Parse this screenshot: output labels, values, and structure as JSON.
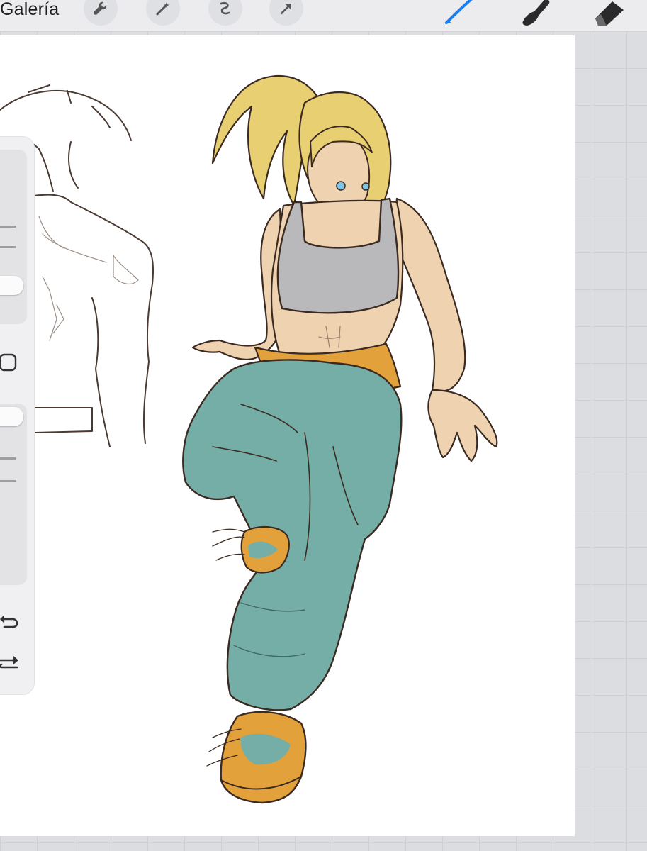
{
  "topbar": {
    "gallery_label": "Galería",
    "tools_left": [
      "wrench-icon",
      "magic-wand-icon",
      "selection-icon",
      "transform-arrow-icon"
    ],
    "tools_right": [
      "brush-icon",
      "smudge-icon",
      "eraser-icon"
    ],
    "active_tool": "brush-icon",
    "accent_color": "#1a7ef2"
  },
  "sidebar": {
    "sliders": [
      "brush-size",
      "opacity"
    ],
    "buttons": [
      "modify-square-icon",
      "undo-icon",
      "redo-icon"
    ]
  },
  "colors": {
    "canvas": "#ffffff",
    "workspace": "#dcdde1",
    "hair": "#e8cf72",
    "skin": "#efd2b0",
    "top": "#b9b9bb",
    "pants": "#74aea6",
    "accent_orange": "#e3a13b",
    "lineart": "#3a2a22"
  }
}
